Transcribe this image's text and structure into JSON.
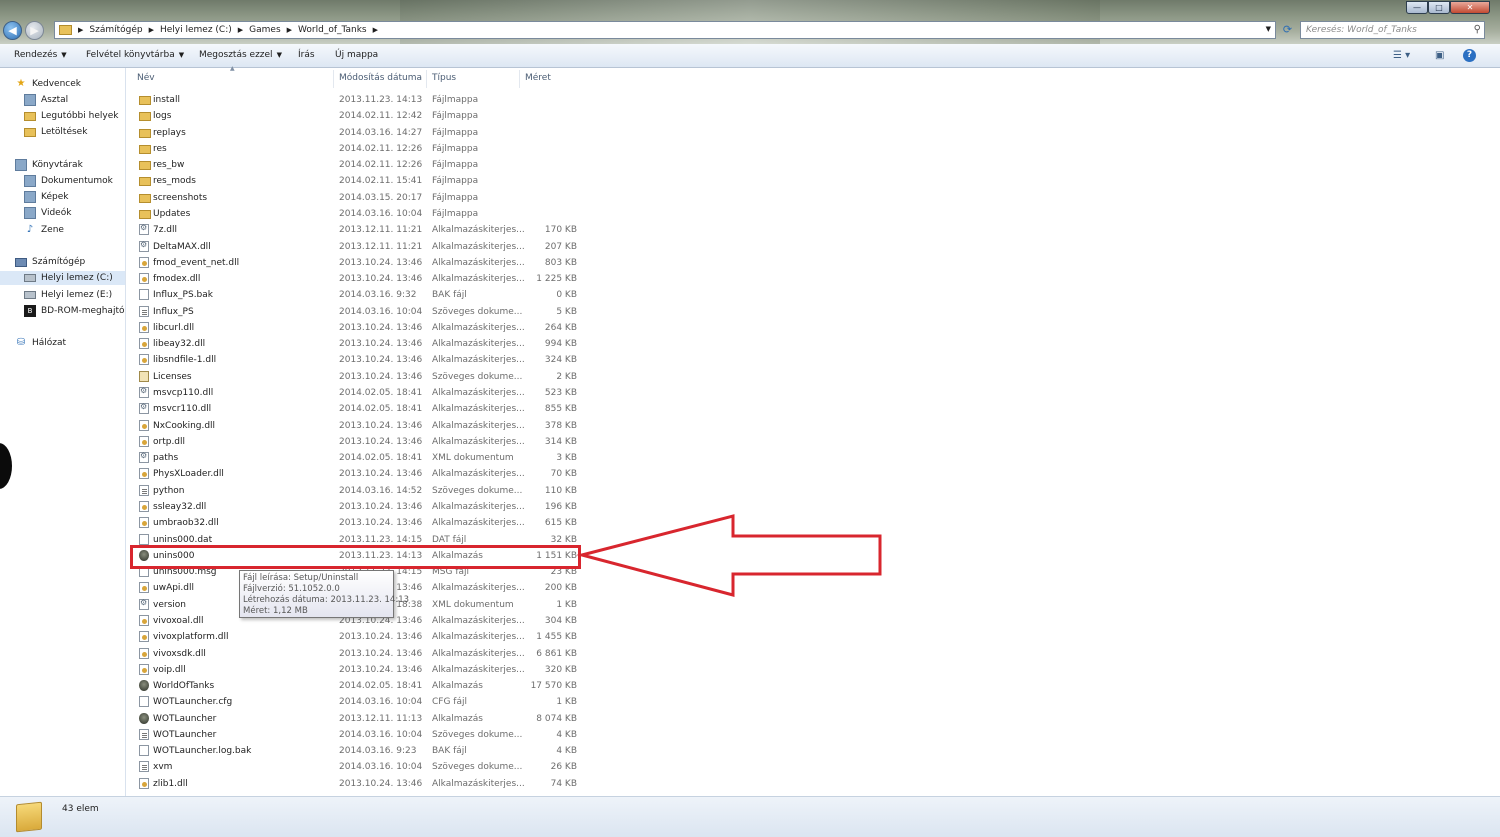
{
  "window": {
    "controls": {
      "minimize": "—",
      "maximize": "□",
      "close": "✕"
    }
  },
  "addressbar": {
    "crumbs": [
      "Számítógép",
      "Helyi lemez (C:)",
      "Games",
      "World_of_Tanks"
    ]
  },
  "search": {
    "placeholder": "Keresés: World_of_Tanks"
  },
  "toolbar": {
    "organize": "Rendezés",
    "include_library": "Felvétel könyvtárba",
    "share": "Megosztás ezzel",
    "burn": "Írás",
    "new_folder": "Új mappa",
    "help": "?"
  },
  "nav": {
    "favorites": "Kedvencek",
    "desktop": "Asztal",
    "recent": "Legutóbbi helyek",
    "downloads": "Letöltések",
    "libraries": "Könyvtárak",
    "documents": "Dokumentumok",
    "pictures": "Képek",
    "videos": "Videók",
    "music": "Zene",
    "computer": "Számítógép",
    "drive_c": "Helyi lemez (C:)",
    "drive_e": "Helyi lemez (E:)",
    "bdrom": "BD-ROM-meghajtó",
    "network": "Hálózat"
  },
  "columns": {
    "name": "Név",
    "date": "Módosítás dátuma",
    "type": "Típus",
    "size": "Méret"
  },
  "files": [
    {
      "name": "install",
      "date": "2013.11.23. 14:13",
      "type": "Fájlmappa",
      "size": "",
      "icon": "folder"
    },
    {
      "name": "logs",
      "date": "2014.02.11. 12:42",
      "type": "Fájlmappa",
      "size": "",
      "icon": "folder"
    },
    {
      "name": "replays",
      "date": "2014.03.16. 14:27",
      "type": "Fájlmappa",
      "size": "",
      "icon": "folder"
    },
    {
      "name": "res",
      "date": "2014.02.11. 12:26",
      "type": "Fájlmappa",
      "size": "",
      "icon": "folder"
    },
    {
      "name": "res_bw",
      "date": "2014.02.11. 12:26",
      "type": "Fájlmappa",
      "size": "",
      "icon": "folder"
    },
    {
      "name": "res_mods",
      "date": "2014.02.11. 15:41",
      "type": "Fájlmappa",
      "size": "",
      "icon": "folder"
    },
    {
      "name": "screenshots",
      "date": "2014.03.15. 20:17",
      "type": "Fájlmappa",
      "size": "",
      "icon": "folder"
    },
    {
      "name": "Updates",
      "date": "2014.03.16. 10:04",
      "type": "Fájlmappa",
      "size": "",
      "icon": "folder"
    },
    {
      "name": "7z.dll",
      "date": "2013.12.11. 11:21",
      "type": "Alkalmazáskiterjes...",
      "size": "170 KB",
      "icon": "gear"
    },
    {
      "name": "DeltaMAX.dll",
      "date": "2013.12.11. 11:21",
      "type": "Alkalmazáskiterjes...",
      "size": "207 KB",
      "icon": "gear"
    },
    {
      "name": "fmod_event_net.dll",
      "date": "2013.10.24. 13:46",
      "type": "Alkalmazáskiterjes...",
      "size": "803 KB",
      "icon": "dll"
    },
    {
      "name": "fmodex.dll",
      "date": "2013.10.24. 13:46",
      "type": "Alkalmazáskiterjes...",
      "size": "1 225 KB",
      "icon": "dll"
    },
    {
      "name": "Influx_PS.bak",
      "date": "2014.03.16. 9:32",
      "type": "BAK fájl",
      "size": "0 KB",
      "icon": "doc"
    },
    {
      "name": "Influx_PS",
      "date": "2014.03.16. 10:04",
      "type": "Szöveges dokume...",
      "size": "5 KB",
      "icon": "txt"
    },
    {
      "name": "libcurl.dll",
      "date": "2013.10.24. 13:46",
      "type": "Alkalmazáskiterjes...",
      "size": "264 KB",
      "icon": "dll"
    },
    {
      "name": "libeay32.dll",
      "date": "2013.10.24. 13:46",
      "type": "Alkalmazáskiterjes...",
      "size": "994 KB",
      "icon": "dll"
    },
    {
      "name": "libsndfile-1.dll",
      "date": "2013.10.24. 13:46",
      "type": "Alkalmazáskiterjes...",
      "size": "324 KB",
      "icon": "dll"
    },
    {
      "name": "Licenses",
      "date": "2013.10.24. 13:46",
      "type": "Szöveges dokume...",
      "size": "2 KB",
      "icon": "lic"
    },
    {
      "name": "msvcp110.dll",
      "date": "2014.02.05. 18:41",
      "type": "Alkalmazáskiterjes...",
      "size": "523 KB",
      "icon": "gear"
    },
    {
      "name": "msvcr110.dll",
      "date": "2014.02.05. 18:41",
      "type": "Alkalmazáskiterjes...",
      "size": "855 KB",
      "icon": "gear"
    },
    {
      "name": "NxCooking.dll",
      "date": "2013.10.24. 13:46",
      "type": "Alkalmazáskiterjes...",
      "size": "378 KB",
      "icon": "dll"
    },
    {
      "name": "ortp.dll",
      "date": "2013.10.24. 13:46",
      "type": "Alkalmazáskiterjes...",
      "size": "314 KB",
      "icon": "dll"
    },
    {
      "name": "paths",
      "date": "2014.02.05. 18:41",
      "type": "XML dokumentum",
      "size": "3 KB",
      "icon": "gear"
    },
    {
      "name": "PhysXLoader.dll",
      "date": "2013.10.24. 13:46",
      "type": "Alkalmazáskiterjes...",
      "size": "70 KB",
      "icon": "dll"
    },
    {
      "name": "python",
      "date": "2014.03.16. 14:52",
      "type": "Szöveges dokume...",
      "size": "110 KB",
      "icon": "txt"
    },
    {
      "name": "ssleay32.dll",
      "date": "2013.10.24. 13:46",
      "type": "Alkalmazáskiterjes...",
      "size": "196 KB",
      "icon": "dll"
    },
    {
      "name": "umbraob32.dll",
      "date": "2013.10.24. 13:46",
      "type": "Alkalmazáskiterjes...",
      "size": "615 KB",
      "icon": "dll"
    },
    {
      "name": "unins000.dat",
      "date": "2013.11.23. 14:15",
      "type": "DAT fájl",
      "size": "32 KB",
      "icon": "doc"
    },
    {
      "name": "unins000",
      "date": "2013.11.23. 14:13",
      "type": "Alkalmazás",
      "size": "1 151 KB",
      "icon": "shield"
    },
    {
      "name": "unins000.msg",
      "date": "2013.11.23. 14:15",
      "type": "MSG fájl",
      "size": "23 KB",
      "icon": "doc"
    },
    {
      "name": "uwApi.dll",
      "date": "2013.10.24. 13:46",
      "type": "Alkalmazáskiterjes...",
      "size": "200 KB",
      "icon": "dll"
    },
    {
      "name": "version",
      "date": "2014.02.05. 18:38",
      "type": "XML dokumentum",
      "size": "1 KB",
      "icon": "gear"
    },
    {
      "name": "vivoxoal.dll",
      "date": "2013.10.24. 13:46",
      "type": "Alkalmazáskiterjes...",
      "size": "304 KB",
      "icon": "dll"
    },
    {
      "name": "vivoxplatform.dll",
      "date": "2013.10.24. 13:46",
      "type": "Alkalmazáskiterjes...",
      "size": "1 455 KB",
      "icon": "dll"
    },
    {
      "name": "vivoxsdk.dll",
      "date": "2013.10.24. 13:46",
      "type": "Alkalmazáskiterjes...",
      "size": "6 861 KB",
      "icon": "dll"
    },
    {
      "name": "voip.dll",
      "date": "2013.10.24. 13:46",
      "type": "Alkalmazáskiterjes...",
      "size": "320 KB",
      "icon": "dll"
    },
    {
      "name": "WorldOfTanks",
      "date": "2014.02.05. 18:41",
      "type": "Alkalmazás",
      "size": "17 570 KB",
      "icon": "shield"
    },
    {
      "name": "WOTLauncher.cfg",
      "date": "2014.03.16. 10:04",
      "type": "CFG fájl",
      "size": "1 KB",
      "icon": "doc"
    },
    {
      "name": "WOTLauncher",
      "date": "2013.12.11. 11:13",
      "type": "Alkalmazás",
      "size": "8 074 KB",
      "icon": "shield"
    },
    {
      "name": "WOTLauncher",
      "date": "2014.03.16. 10:04",
      "type": "Szöveges dokume...",
      "size": "4 KB",
      "icon": "txt"
    },
    {
      "name": "WOTLauncher.log.bak",
      "date": "2014.03.16. 9:23",
      "type": "BAK fájl",
      "size": "4 KB",
      "icon": "doc"
    },
    {
      "name": "xvm",
      "date": "2014.03.16. 10:04",
      "type": "Szöveges dokume...",
      "size": "26 KB",
      "icon": "txt"
    },
    {
      "name": "zlib1.dll",
      "date": "2013.10.24. 13:46",
      "type": "Alkalmazáskiterjes...",
      "size": "74 KB",
      "icon": "dll"
    }
  ],
  "tooltip": {
    "line1": "Fájl leírása: Setup/Uninstall",
    "line2": "Fájlverzió: 51.1052.0.0",
    "line3": "Létrehozás dátuma: 2013.11.23. 14:13",
    "line4": "Méret: 1,12 MB"
  },
  "status": {
    "count": "43 elem"
  },
  "annotation": {
    "color": "#d8262e"
  }
}
